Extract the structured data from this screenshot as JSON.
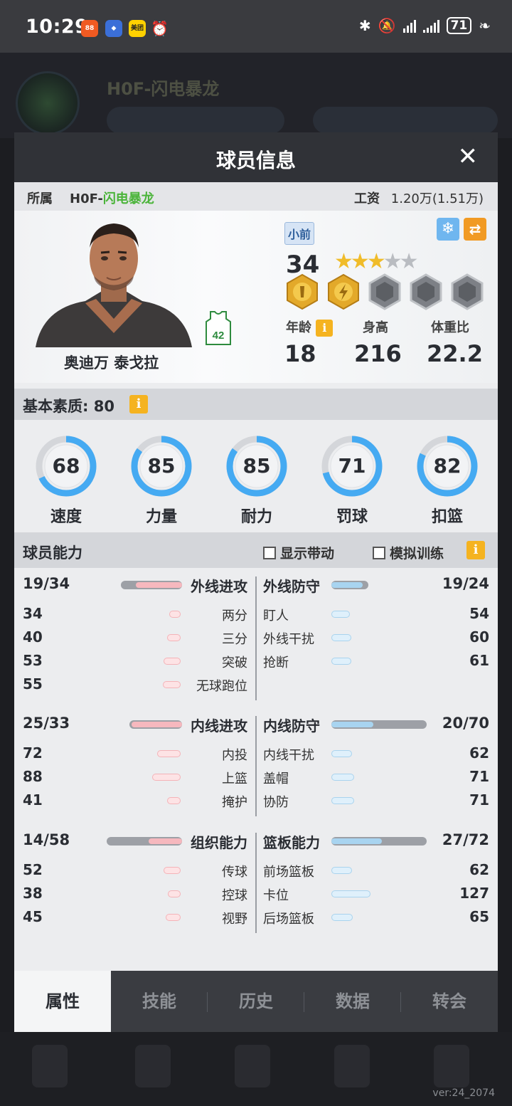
{
  "status_bar": {
    "time": "10:29",
    "app_badges": [
      "app-icon-orange",
      "app-icon-blue",
      "美团",
      "alarm-icon"
    ],
    "battery": "71"
  },
  "background": {
    "team_title": "H0F-闪电暴龙",
    "version": "ver:24_2074"
  },
  "modal": {
    "title": "球员信息",
    "close_icon": "close-icon"
  },
  "affiliation": {
    "label": "所属",
    "team_prefix": "H0F-",
    "team_name": "闪电暴龙",
    "salary_label": "工资",
    "salary_value": "1.20万(1.51万)"
  },
  "player": {
    "name": "奥迪万 泰戈拉",
    "jersey_number": "42",
    "position": "小前",
    "overall": "34",
    "stars_filled": 3,
    "stars_total": 5,
    "attributes": [
      {
        "label": "年龄",
        "value": "18",
        "info": true
      },
      {
        "label": "身高",
        "value": "216",
        "info": false
      },
      {
        "label": "体重比",
        "value": "22.2",
        "info": false
      }
    ]
  },
  "basic": {
    "label": "基本素质: 80",
    "gauges": [
      {
        "label": "速度",
        "value": 68
      },
      {
        "label": "力量",
        "value": 85
      },
      {
        "label": "耐力",
        "value": 85
      },
      {
        "label": "罚球",
        "value": 71
      },
      {
        "label": "扣篮",
        "value": 82
      }
    ]
  },
  "ability": {
    "label": "球员能力",
    "check_show": "显示带动",
    "check_train": "模拟训练",
    "groups": [
      {
        "left": {
          "value": "19/34",
          "name": "外线进攻",
          "ratio": 0.56,
          "subs": [
            {
              "value": "34",
              "name": "两分"
            },
            {
              "value": "40",
              "name": "三分"
            },
            {
              "value": "53",
              "name": "突破"
            },
            {
              "value": "55",
              "name": "无球跑位"
            }
          ]
        },
        "right": {
          "value": "19/24",
          "name": "外线防守",
          "ratio": 0.79,
          "subs": [
            {
              "value": "54",
              "name": "盯人"
            },
            {
              "value": "60",
              "name": "外线干扰"
            },
            {
              "value": "61",
              "name": "抢断"
            }
          ]
        }
      },
      {
        "left": {
          "value": "25/33",
          "name": "内线进攻",
          "ratio": 0.76,
          "subs": [
            {
              "value": "72",
              "name": "内投"
            },
            {
              "value": "88",
              "name": "上篮"
            },
            {
              "value": "41",
              "name": "掩护"
            }
          ]
        },
        "right": {
          "value": "20/70",
          "name": "内线防守",
          "ratio": 0.29,
          "subs": [
            {
              "value": "62",
              "name": "内线干扰"
            },
            {
              "value": "71",
              "name": "盖帽"
            },
            {
              "value": "71",
              "name": "协防"
            }
          ]
        }
      },
      {
        "left": {
          "value": "14/58",
          "name": "组织能力",
          "ratio": 0.24,
          "subs": [
            {
              "value": "52",
              "name": "传球"
            },
            {
              "value": "38",
              "name": "控球"
            },
            {
              "value": "45",
              "name": "视野"
            }
          ]
        },
        "right": {
          "value": "27/72",
          "name": "篮板能力",
          "ratio": 0.38,
          "subs": [
            {
              "value": "62",
              "name": "前场篮板"
            },
            {
              "value": "127",
              "name": "卡位"
            },
            {
              "value": "65",
              "name": "后场篮板"
            }
          ]
        }
      }
    ]
  },
  "tabs": [
    "属性",
    "技能",
    "历史",
    "数据",
    "转会"
  ],
  "colors": {
    "accent_green": "#4bb43a",
    "info_yellow": "#f5b320",
    "gauge_blue": "#45aaf2"
  }
}
